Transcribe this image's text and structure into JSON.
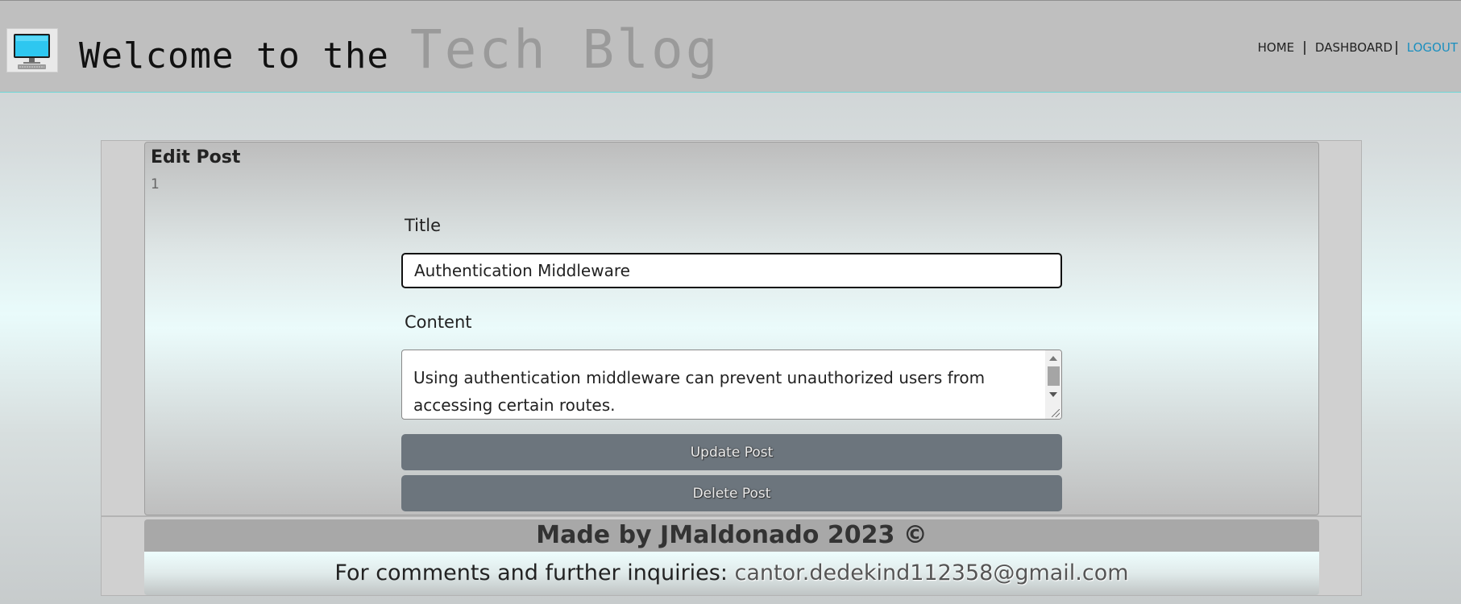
{
  "header": {
    "welcome_text": "Welcome to the",
    "brand_name": "Tech Blog",
    "nav": {
      "home": "HOME",
      "separator": "|",
      "dashboard": "DASHBOARD",
      "logout": "LOGOUT"
    },
    "logo_icon": "computer-monitor-icon"
  },
  "edit_post": {
    "heading": "Edit Post",
    "post_id": "1",
    "title_label": "Title",
    "title_value": "Authentication Middleware",
    "content_label": "Content",
    "content_value": "Using authentication middleware can prevent unauthorized users from accessing certain routes.",
    "update_button": "Update Post",
    "delete_button": "Delete Post"
  },
  "footer": {
    "made_by": "Made by JMaldonado 2023 ©",
    "inquiries_label": "For comments and further inquiries:",
    "email": "cantor.dedekind112358@gmail.com"
  },
  "colors": {
    "header_bg": "#bfbfbf",
    "brand_muted": "#9a9a9a",
    "logout_link": "#1b8fbf",
    "button_bg": "#6c757d",
    "footer_top_bg": "#a8a8a8"
  }
}
